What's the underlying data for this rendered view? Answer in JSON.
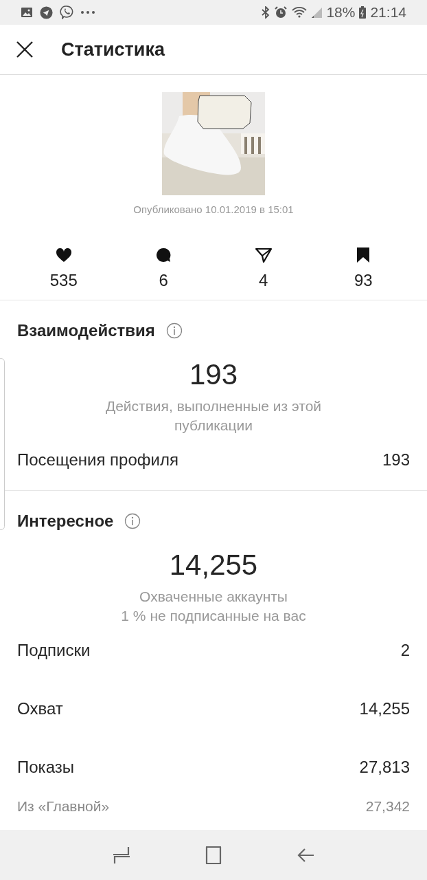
{
  "status_bar": {
    "battery": "18%",
    "time": "21:14"
  },
  "header": {
    "title": "Статистика"
  },
  "post": {
    "published": "Опубликовано 10.01.2019 в 15:01"
  },
  "counters": [
    {
      "kind": "likes",
      "value": "535"
    },
    {
      "kind": "comments",
      "value": "6"
    },
    {
      "kind": "shares",
      "value": "4"
    },
    {
      "kind": "saves",
      "value": "93"
    }
  ],
  "sections": [
    {
      "title": "Взаимодействия",
      "big_number": "193",
      "caption": [
        "Действия, выполненные из этой публикации"
      ],
      "rows": [
        {
          "label": "Посещения профиля",
          "value": "193"
        }
      ]
    },
    {
      "title": "Интересное",
      "big_number": "14,255",
      "caption": [
        "Охваченные аккаунты",
        "1 % не подписанные на вас"
      ],
      "rows": [
        {
          "label": "Подписки",
          "value": "2"
        },
        {
          "label": "Охват",
          "value": "14,255"
        },
        {
          "label": "Показы",
          "value": "27,813"
        },
        {
          "label": "Из «Главной»",
          "value": "27,342",
          "kind": "sub"
        }
      ]
    }
  ]
}
